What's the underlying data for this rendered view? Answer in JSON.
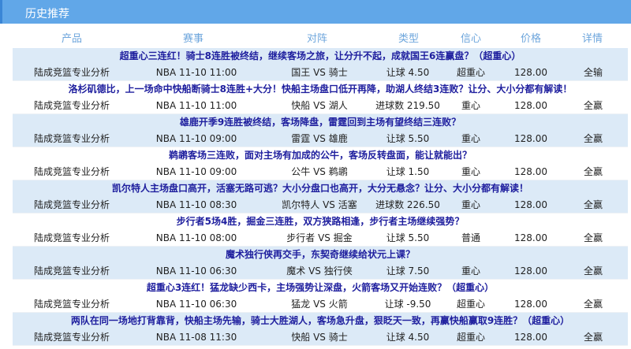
{
  "section_title": "历史推荐",
  "columns": {
    "product": "产品",
    "match": "赛事",
    "matchup": "对阵",
    "type": "类型",
    "confidence": "信心",
    "price": "价格",
    "detail": "详情"
  },
  "rows": [
    {
      "title": "超重心三连红！骑士8连胜被终结，继续客场之旅，让分升不起，成就国王6连赢盘？（超重心）",
      "product": "陆成竞篮专业分析",
      "match": "NBA 11-10 11:00",
      "matchup": "国王 VS 骑士",
      "type": "让球 4.50",
      "confidence": "超重心",
      "price": "128.00",
      "result": "全输"
    },
    {
      "title": "洛杉矶德比，上一场命中快船断骑士8连胜+大分！快船主场盘口低开再降，助湖人终结3连败？让分、大小分都有解读！",
      "product": "陆成竞篮专业分析",
      "match": "NBA 11-10 11:00",
      "matchup": "快船 VS 湖人",
      "type": "进球数 219.50",
      "confidence": "重心",
      "price": "128.00",
      "result": "全赢"
    },
    {
      "title": "雄鹿开季9连胜被终结，客场降盘，雷霆回到主场有望终结三连败？",
      "product": "陆成竞篮专业分析",
      "match": "NBA 11-10 09:00",
      "matchup": "雷霆 VS 雄鹿",
      "type": "让球 5.50",
      "confidence": "重心",
      "price": "128.00",
      "result": "全赢"
    },
    {
      "title": "鹈鹕客场三连败，面对主场有加成的公牛，客场反转盘面，能让就能出？",
      "product": "陆成竞篮专业分析",
      "match": "NBA 11-10 09:00",
      "matchup": "公牛 VS 鹈鹕",
      "type": "让球 1.50",
      "confidence": "重心",
      "price": "128.00",
      "result": "全赢"
    },
    {
      "title": "凯尔特人主场盘口高开，活塞无路可逃？大小分盘口也高开，大分无悬念？让分、大小分都有解读！",
      "product": "陆成竞篮专业分析",
      "match": "NBA 11-10 08:30",
      "matchup": "凯尔特人 VS 活塞",
      "type": "进球数 226.50",
      "confidence": "重心",
      "price": "128.00",
      "result": "全赢"
    },
    {
      "title": "步行者5场4胜，掘金三连胜，双方狭路相逢，步行者主场继续强势？",
      "product": "陆成竞篮专业分析",
      "match": "NBA 11-10 08:00",
      "matchup": "步行者 VS 掘金",
      "type": "让球 5.50",
      "confidence": "普通",
      "price": "128.00",
      "result": "全赢"
    },
    {
      "title": "魔术独行侠再交手，东契奇继续给状元上课？",
      "product": "陆成竞篮专业分析",
      "match": "NBA 11-10 06:30",
      "matchup": "魔术 VS 独行侠",
      "type": "让球 7.50",
      "confidence": "重心",
      "price": "128.00",
      "result": "全赢"
    },
    {
      "title": "超重心3连红！猛龙缺少西卡，主场强势让深盘，火箭客场又开始连败？（超重心）",
      "product": "陆成竞篮专业分析",
      "match": "NBA 11-10 06:30",
      "matchup": "猛龙 VS 火箭",
      "type": "让球 -9.50",
      "confidence": "超重心",
      "price": "128.00",
      "result": "全赢"
    },
    {
      "title": "两队在同一场地打背靠背，快船主场先输，骑士大胜湖人，客场急升盘，狠眨天一致，再赢快船赢取9连胜？（超重心）",
      "product": "陆成竞篮专业分析",
      "match": "NBA 11-08 11:30",
      "matchup": "快船 VS 骑士",
      "type": "让球 4.50",
      "confidence": "超重心",
      "price": "128.00",
      "result": "全赢"
    }
  ]
}
